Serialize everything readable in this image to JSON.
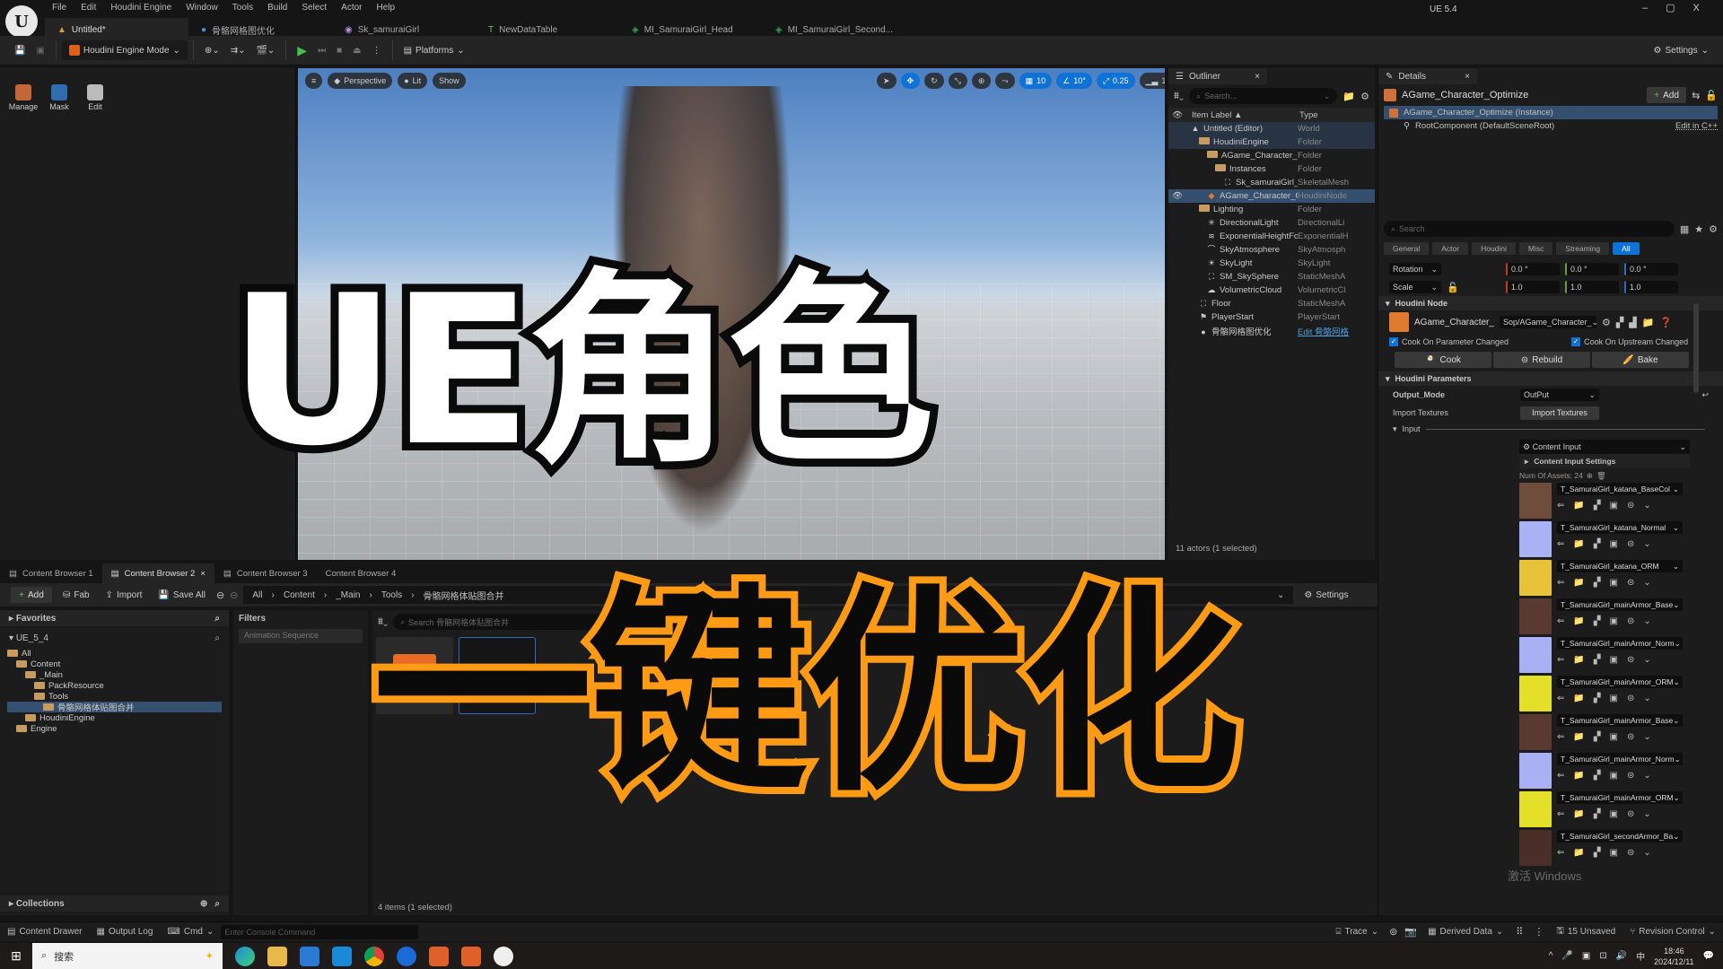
{
  "window": {
    "menu": [
      "File",
      "Edit",
      "Houdini Engine",
      "Window",
      "Tools",
      "Build",
      "Select",
      "Actor",
      "Help"
    ],
    "tabs": [
      {
        "label": "Untitled*",
        "icon": "level-icon",
        "active": true
      },
      {
        "label": "骨骼网格图优化",
        "icon": "blueprint-icon"
      },
      {
        "label": "Sk_samuraiGirl",
        "icon": "skeletal-mesh-icon"
      },
      {
        "label": "NewDataTable",
        "icon": "datatable-icon"
      },
      {
        "label": "MI_SamuraiGirl_Head",
        "icon": "material-instance-icon"
      },
      {
        "label": "MI_SamuraiGirl_Second...",
        "icon": "material-instance-icon"
      }
    ],
    "version": "UE 5.4",
    "controls": {
      "minimize": "–",
      "maximize": "▢",
      "close": "X"
    }
  },
  "toolbar": {
    "mode": "Houdini Engine Mode",
    "platforms": "Platforms",
    "settings": "Settings"
  },
  "modes_panel": {
    "items": [
      {
        "label": "Manage"
      },
      {
        "label": "Mask"
      },
      {
        "label": "Edit"
      }
    ]
  },
  "viewport": {
    "menu_label": "≡",
    "perspective": "Perspective",
    "lit": "Lit",
    "show": "Show",
    "grid_snap": "10",
    "rot_snap": "10°",
    "scale_snap": "0.25",
    "camera_speed": "1"
  },
  "outliner": {
    "tab": "Outliner",
    "search_placeholder": "Search...",
    "col_label": "Item Label ▲",
    "col_type": "Type",
    "rows": [
      {
        "label": "Untitled (Editor)",
        "type": "World",
        "indent": 1,
        "kind": "world"
      },
      {
        "label": "HoudiniEngine",
        "type": "Folder",
        "indent": 2,
        "kind": "folder"
      },
      {
        "label": "AGame_Character_Opti",
        "type": "Folder",
        "indent": 3,
        "kind": "folder"
      },
      {
        "label": "Instances",
        "type": "Folder",
        "indent": 4,
        "kind": "folder"
      },
      {
        "label": "Sk_samuraiGirl_H",
        "type": "SkeletalMesh",
        "indent": 5,
        "kind": "mesh"
      },
      {
        "label": "AGame_Character_Opti",
        "type": "HoudiniNode",
        "indent": 3,
        "kind": "houdini",
        "selected": true
      },
      {
        "label": "Lighting",
        "type": "Folder",
        "indent": 2,
        "kind": "folder"
      },
      {
        "label": "DirectionalLight",
        "type": "DirectionalLi",
        "indent": 3,
        "kind": "light"
      },
      {
        "label": "ExponentialHeightFog",
        "type": "ExponentialH",
        "indent": 3,
        "kind": "fog"
      },
      {
        "label": "SkyAtmosphere",
        "type": "SkyAtmosph",
        "indent": 3,
        "kind": "sky"
      },
      {
        "label": "SkyLight",
        "type": "SkyLight",
        "indent": 3,
        "kind": "skylight"
      },
      {
        "label": "SM_SkySphere",
        "type": "StaticMeshA",
        "indent": 3,
        "kind": "mesh"
      },
      {
        "label": "VolumetricCloud",
        "type": "VolumetricCl",
        "indent": 3,
        "kind": "cloud"
      },
      {
        "label": "Floor",
        "type": "StaticMeshA",
        "indent": 2,
        "kind": "mesh"
      },
      {
        "label": "PlayerStart",
        "type": "PlayerStart",
        "indent": 2,
        "kind": "player"
      },
      {
        "label": "骨骼网格图优化",
        "type": "Edit 骨骼网格",
        "indent": 2,
        "kind": "blueprint"
      }
    ],
    "footer": "11 actors (1 selected)"
  },
  "details": {
    "tab": "Details",
    "actor_name": "AGame_Character_Optimize",
    "add_label": "Add",
    "instance_label": "AGame_Character_Optimize (Instance)",
    "root_component": "RootComponent (DefaultSceneRoot)",
    "edit_cpp": "Edit in C++",
    "search_placeholder": "Search",
    "categories": [
      "General",
      "Actor",
      "Houdini",
      "Misc",
      "Streaming",
      "All"
    ],
    "active_category": "All",
    "rotation": {
      "label": "Rotation",
      "x": "0.0 °",
      "y": "0.0 °",
      "z": "0.0 °"
    },
    "scale": {
      "label": "Scale",
      "x": "1.0",
      "y": "1.0",
      "z": "1.0"
    },
    "houdini_node": {
      "header": "Houdini Node",
      "name": "AGame_Character_",
      "asset": "Sop/AGame_Character_",
      "cook_on_param": "Cook On Parameter Changed",
      "cook_on_upstream": "Cook On Upstream Changed",
      "cook": "Cook",
      "rebuild": "Rebuild",
      "bake": "Bake"
    },
    "houdini_params": {
      "header": "Houdini Parameters",
      "output_mode_label": "Output_Mode",
      "output_mode_value": "OutPut",
      "import_textures_label": "Import Textures",
      "import_textures_button": "Import Textures",
      "input_label": "Input",
      "content_input": "Content Input",
      "content_input_settings": "Content Input Settings",
      "num_assets": "Num Of Assets: 24"
    },
    "assets": [
      {
        "name": "T_SamuraiGirl_katana_BaseCol",
        "color": "#6e4d3d"
      },
      {
        "name": "T_SamuraiGirl_katana_Normal",
        "color": "#aab2f5"
      },
      {
        "name": "T_SamuraiGirl_katana_ORM",
        "color": "#e8c33a"
      },
      {
        "name": "T_SamuraiGirl_mainArmor_Base",
        "color": "#5a3a30"
      },
      {
        "name": "T_SamuraiGirl_mainArmor_Norm",
        "color": "#a9b0f3"
      },
      {
        "name": "T_SamuraiGirl_mainArmor_ORM",
        "color": "#e4e02a"
      },
      {
        "name": "T_SamuraiGirl_mainArmor_Base",
        "color": "#5a3a30"
      },
      {
        "name": "T_SamuraiGirl_mainArmor_Norm",
        "color": "#a9b0f3"
      },
      {
        "name": "T_SamuraiGirl_mainArmor_ORM",
        "color": "#e4e02a"
      },
      {
        "name": "T_SamuraiGirl_secondArmor_Ba",
        "color": "#4a2e28"
      }
    ]
  },
  "content_browser": {
    "tabs": [
      "Content Browser 1",
      "Content Browser 2",
      "Content Browser 3",
      "Content Browser 4"
    ],
    "active_tab": 1,
    "add": "Add",
    "fab": "Fab",
    "import": "Import",
    "save_all": "Save All",
    "path": [
      "All",
      "Content",
      "_Main",
      "Tools",
      "骨骼网格体贴图合并"
    ],
    "settings": "Settings",
    "favorites": "Favorites",
    "project": "UE_5_4",
    "tree": [
      {
        "label": "All",
        "indent": 0
      },
      {
        "label": "Content",
        "indent": 1
      },
      {
        "label": "_Main",
        "indent": 2
      },
      {
        "label": "PackResource",
        "indent": 3
      },
      {
        "label": "Tools",
        "indent": 3
      },
      {
        "label": "骨骼网格体贴图合并",
        "indent": 4,
        "selected": true
      },
      {
        "label": "HoudiniEngine",
        "indent": 2
      },
      {
        "label": "Engine",
        "indent": 1
      }
    ],
    "collections": "Collections",
    "filters": "Filters",
    "filter_chip": "Animation Sequence",
    "search_placeholder": "Search 骨骼网格体贴图合并",
    "item_count": "4 items (1 selected)"
  },
  "statusbar": {
    "content_drawer": "Content Drawer",
    "output_log": "Output Log",
    "cmd": "Cmd",
    "console_placeholder": "Enter Console Command",
    "trace": "Trace",
    "derived_data": "Derived Data",
    "unsaved": "15 Unsaved",
    "revision_control": "Revision Control"
  },
  "taskbar": {
    "search": "搜索",
    "ime": "中",
    "time": "18:46",
    "date": "2024/12/11"
  },
  "overlay": {
    "line1": "UE角色",
    "line2": "一键优化",
    "watermark": "激活 Windows"
  }
}
